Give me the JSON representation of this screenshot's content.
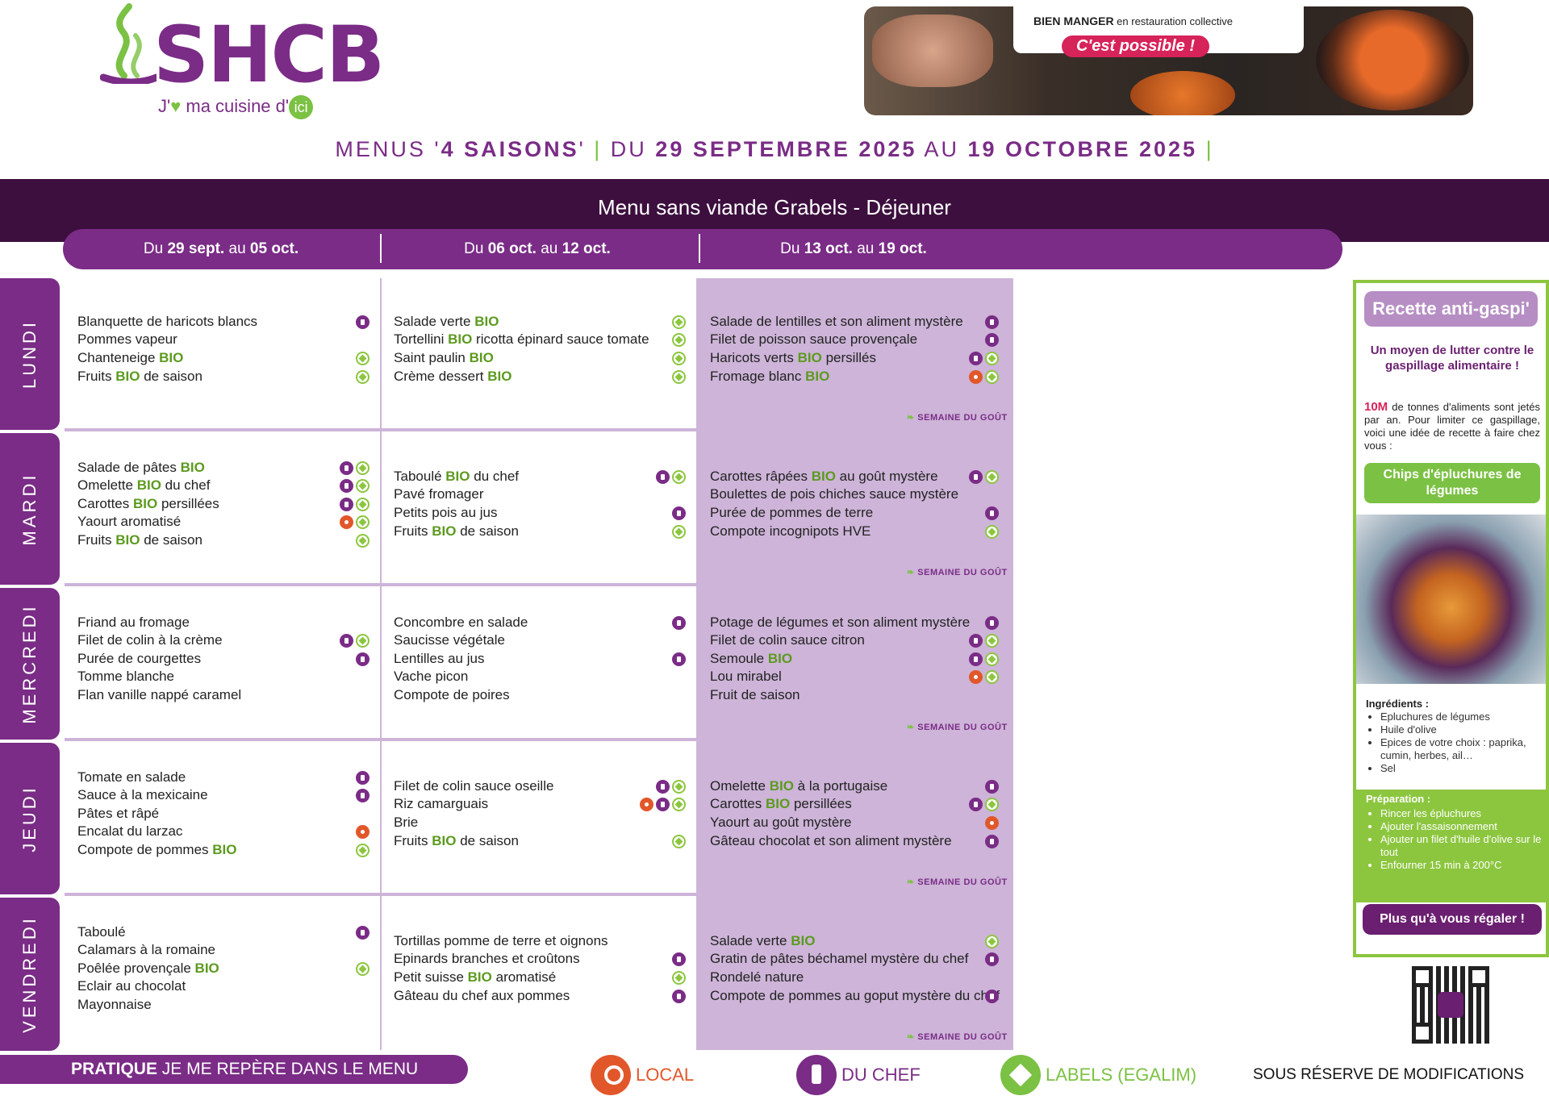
{
  "logo": {
    "brand": "SHCB",
    "tagline_pre": "J'",
    "tagline_heart": "♥",
    "tagline_mid": " ma cuisine d'",
    "tagline_ici": "ici"
  },
  "banner": {
    "line1_bold": "BIEN MANGER",
    "line1_rest": " en restauration collective",
    "line2": "C'est possible !"
  },
  "title": {
    "p1": "MENUS '",
    "p2": "4 SAISONS",
    "p3": "' ",
    "sep1": "|",
    "p4": " DU ",
    "d1": "29 SEPTEMBRE 2025",
    "p5": " AU ",
    "d2": "19 OCTOBRE 2025",
    "sep2": " |"
  },
  "menu_name": "Menu sans viande Grabels - Déjeuner",
  "weeks": [
    {
      "pre": "Du ",
      "a": "29 sept.",
      "mid": " au ",
      "b": "05 oct."
    },
    {
      "pre": "Du ",
      "a": "06 oct.",
      "mid": " au ",
      "b": "12 oct."
    },
    {
      "pre": "Du ",
      "a": "13 oct.",
      "mid": " au ",
      "b": "19 oct."
    }
  ],
  "days": [
    "LUNDI",
    "MARDI",
    "MERCREDI",
    "JEUDI",
    "VENDREDI"
  ],
  "semaine_du_gout": "SEMAINE DU GOÛT",
  "grid": [
    [
      [
        {
          "t": [
            "Blanquette de haricots blancs"
          ],
          "ic": [
            "chef"
          ]
        },
        {
          "t": [
            "Pommes vapeur"
          ],
          "ic": []
        },
        {
          "t": [
            "Chanteneige ",
            "BIO"
          ],
          "ic": [
            "label"
          ]
        },
        {
          "t": [
            "Fruits ",
            "BIO",
            " de saison"
          ],
          "ic": [
            "label"
          ]
        }
      ],
      [
        {
          "t": [
            "Salade verte ",
            "BIO"
          ],
          "ic": [
            "label"
          ]
        },
        {
          "t": [
            "Tortellini ",
            "BIO",
            " ricotta épinard sauce tomate"
          ],
          "ic": [
            "label"
          ]
        },
        {
          "t": [
            "Saint paulin ",
            "BIO"
          ],
          "ic": [
            "label"
          ]
        },
        {
          "t": [
            "Crème dessert ",
            "BIO"
          ],
          "ic": [
            "label"
          ]
        }
      ],
      [
        {
          "t": [
            "Salade de lentilles et son aliment mystère"
          ],
          "ic": [
            "chef"
          ]
        },
        {
          "t": [
            "Filet de poisson sauce provençale"
          ],
          "ic": [
            "chef"
          ]
        },
        {
          "t": [
            "Haricots verts ",
            "BIO",
            " persillés"
          ],
          "ic": [
            "chef",
            "label"
          ]
        },
        {
          "t": [
            "Fromage blanc ",
            "BIO"
          ],
          "ic": [
            "local",
            "label"
          ]
        }
      ]
    ],
    [
      [
        {
          "t": [
            "Salade de pâtes ",
            "BIO"
          ],
          "ic": [
            "chef",
            "label"
          ]
        },
        {
          "t": [
            "Omelette ",
            "BIO",
            " du chef"
          ],
          "ic": [
            "chef",
            "label"
          ]
        },
        {
          "t": [
            "Carottes ",
            "BIO",
            " persillées"
          ],
          "ic": [
            "chef",
            "label"
          ]
        },
        {
          "t": [
            "Yaourt aromatisé"
          ],
          "ic": [
            "local",
            "label"
          ]
        },
        {
          "t": [
            "Fruits ",
            "BIO",
            " de saison"
          ],
          "ic": [
            "label"
          ]
        }
      ],
      [
        {
          "t": [
            "Taboulé ",
            "BIO",
            " du chef"
          ],
          "ic": [
            "chef",
            "label"
          ]
        },
        {
          "t": [
            "Pavé fromager"
          ],
          "ic": []
        },
        {
          "t": [
            "Petits pois au jus"
          ],
          "ic": [
            "chef"
          ]
        },
        {
          "t": [
            "Fruits ",
            "BIO",
            " de saison"
          ],
          "ic": [
            "label"
          ]
        }
      ],
      [
        {
          "t": [
            "Carottes râpées ",
            "BIO",
            " au goût mystère"
          ],
          "ic": [
            "chef",
            "label"
          ]
        },
        {
          "t": [
            "Boulettes de pois chiches sauce mystère"
          ],
          "ic": []
        },
        {
          "t": [
            "Purée de pommes de terre"
          ],
          "ic": [
            "chef"
          ]
        },
        {
          "t": [
            "Compote incognipots HVE"
          ],
          "ic": [
            "label"
          ]
        }
      ]
    ],
    [
      [
        {
          "t": [
            "Friand au fromage"
          ],
          "ic": []
        },
        {
          "t": [
            "Filet de colin à la crème"
          ],
          "ic": [
            "chef",
            "label"
          ]
        },
        {
          "t": [
            "Purée de courgettes"
          ],
          "ic": [
            "chef"
          ]
        },
        {
          "t": [
            "Tomme blanche"
          ],
          "ic": []
        },
        {
          "t": [
            "Flan vanille nappé caramel"
          ],
          "ic": []
        }
      ],
      [
        {
          "t": [
            "Concombre en salade"
          ],
          "ic": [
            "chef"
          ]
        },
        {
          "t": [
            "Saucisse végétale"
          ],
          "ic": []
        },
        {
          "t": [
            "Lentilles au jus"
          ],
          "ic": [
            "chef"
          ]
        },
        {
          "t": [
            "Vache picon"
          ],
          "ic": []
        },
        {
          "t": [
            "Compote de poires"
          ],
          "ic": []
        }
      ],
      [
        {
          "t": [
            "Potage de légumes et son aliment mystère"
          ],
          "ic": [
            "chef"
          ]
        },
        {
          "t": [
            "Filet de colin sauce citron"
          ],
          "ic": [
            "chef",
            "label"
          ]
        },
        {
          "t": [
            "Semoule ",
            "BIO"
          ],
          "ic": [
            "chef",
            "label"
          ]
        },
        {
          "t": [
            "Lou mirabel"
          ],
          "ic": [
            "local",
            "label"
          ]
        },
        {
          "t": [
            "Fruit de saison"
          ],
          "ic": []
        }
      ]
    ],
    [
      [
        {
          "t": [
            "Tomate en salade"
          ],
          "ic": [
            "chef"
          ]
        },
        {
          "t": [
            "Sauce à la mexicaine"
          ],
          "ic": [
            "chef"
          ]
        },
        {
          "t": [
            "Pâtes et râpé"
          ],
          "ic": []
        },
        {
          "t": [
            "Encalat du larzac"
          ],
          "ic": [
            "local"
          ]
        },
        {
          "t": [
            "Compote de pommes ",
            "BIO"
          ],
          "ic": [
            "label"
          ]
        }
      ],
      [
        {
          "t": [
            "Filet de colin sauce oseille"
          ],
          "ic": [
            "chef",
            "label"
          ]
        },
        {
          "t": [
            "Riz camarguais"
          ],
          "ic": [
            "local",
            "chef",
            "label"
          ]
        },
        {
          "t": [
            "Brie"
          ],
          "ic": []
        },
        {
          "t": [
            "Fruits ",
            "BIO",
            " de saison"
          ],
          "ic": [
            "label"
          ]
        }
      ],
      [
        {
          "t": [
            "Omelette ",
            "BIO",
            " à la portugaise"
          ],
          "ic": [
            "chef"
          ]
        },
        {
          "t": [
            "Carottes ",
            "BIO",
            " persillées"
          ],
          "ic": [
            "chef",
            "label"
          ]
        },
        {
          "t": [
            "Yaourt au goût mystère"
          ],
          "ic": [
            "local"
          ]
        },
        {
          "t": [
            "Gâteau chocolat et son aliment mystère"
          ],
          "ic": [
            "chef"
          ]
        }
      ]
    ],
    [
      [
        {
          "t": [
            "Taboulé"
          ],
          "ic": [
            "chef"
          ]
        },
        {
          "t": [
            "Calamars à la romaine"
          ],
          "ic": []
        },
        {
          "t": [
            "Poêlée provençale ",
            "BIO"
          ],
          "ic": [
            "label"
          ]
        },
        {
          "t": [
            "Eclair au chocolat"
          ],
          "ic": []
        },
        {
          "t": [
            "Mayonnaise"
          ],
          "ic": []
        }
      ],
      [
        {
          "t": [
            "Tortillas pomme de terre et oignons"
          ],
          "ic": []
        },
        {
          "t": [
            "Epinards branches et croûtons"
          ],
          "ic": [
            "chef"
          ]
        },
        {
          "t": [
            "Petit suisse ",
            "BIO",
            " aromatisé"
          ],
          "ic": [
            "label"
          ]
        },
        {
          "t": [
            "Gâteau du chef aux pommes"
          ],
          "ic": [
            "chef"
          ]
        }
      ],
      [
        {
          "t": [
            "Salade verte ",
            "BIO"
          ],
          "ic": [
            "label"
          ]
        },
        {
          "t": [
            "Gratin de pâtes béchamel mystère du chef"
          ],
          "ic": [
            "chef"
          ]
        },
        {
          "t": [
            "Rondelé nature"
          ],
          "ic": []
        },
        {
          "t": [
            "Compote de pommes au goput mystère du chef"
          ],
          "ic": [
            "chef"
          ]
        }
      ]
    ]
  ],
  "sidebar": {
    "title": "Recette anti-gaspi'",
    "subtitle": "Un moyen de lutter contre le gaspillage alimentaire !",
    "fact_num": "10M",
    "fact_text": " de tonnes d'aliments sont jetés par an. Pour limiter ce gaspillage, voici une idée de recette à faire chez vous :",
    "recipe": "Chips d'épluchures de légumes",
    "ingredients_title": "Ingrédients :",
    "ingredients": [
      "Epluchures de légumes",
      "Huile d'olive",
      "Epices de votre choix : paprika, cumin, herbes, ail…",
      "Sel"
    ],
    "prep_title": "Préparation :",
    "prep": [
      "Rincer les épluchures",
      "Ajouter l'assaisonnement",
      "Ajouter un filet d'huile d'olive sur le tout",
      "Enfourner 15 min à 200°C"
    ],
    "enjoy": "Plus qu'à vous régaler !"
  },
  "footer": {
    "pratique_bold": "PRATIQUE",
    "pratique_rest": " JE ME REPÈRE DANS LE MENU",
    "local": "LOCAL",
    "chef": "DU CHEF",
    "labels": "LABELS (EGALIM)",
    "reserve": "SOUS RÉSERVE DE MODIFICATIONS"
  },
  "colors": {
    "purple": "#7a2c86",
    "dark_purple": "#3c0f3e",
    "green": "#7bc143",
    "bio_green": "#5c9a1f",
    "local_orange": "#e2572a",
    "lavender": "#cdb4d8"
  }
}
